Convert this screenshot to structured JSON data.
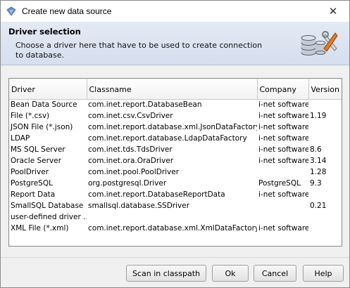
{
  "window": {
    "title": "Create new data source"
  },
  "header": {
    "title": "Driver selection",
    "description": "Choose a driver here that have to be used to create connection to database."
  },
  "table": {
    "columns": [
      "Driver",
      "Classname",
      "Company",
      "Version"
    ],
    "rows": [
      [
        "Bean Data Source",
        "com.inet.report.DatabaseBean",
        "i-net software",
        ""
      ],
      [
        "File (*.csv)",
        "com.inet.csv.CsvDriver",
        "i-net software",
        "1.19"
      ],
      [
        "JSON File (*.json)",
        "com.inet.report.database.xml.JsonDataFactory",
        "i-net software",
        ""
      ],
      [
        "LDAP",
        "com.inet.report.database.LdapDataFactory",
        "i-net software",
        ""
      ],
      [
        "MS SQL Server",
        "com.inet.tds.TdsDriver",
        "i-net software",
        "8.6"
      ],
      [
        "Oracle Server",
        "com.inet.ora.OraDriver",
        "i-net software",
        "3.14"
      ],
      [
        "PoolDriver",
        "com.inet.pool.PoolDriver",
        "",
        "1.28"
      ],
      [
        "PostgreSQL",
        "org.postgresql.Driver",
        "PostgreSQL",
        "9.3"
      ],
      [
        "Report Data",
        "com.inet.report.DatabaseReportData",
        "i-net software",
        ""
      ],
      [
        "SmallSQL Database",
        "smallsql.database.SSDriver",
        "",
        "0.21"
      ],
      [
        "user-defined driver ..",
        "",
        "",
        ""
      ],
      [
        "XML File (*.xml)",
        "com.inet.report.database.xml.XmlDataFactory",
        "i-net software",
        ""
      ]
    ]
  },
  "buttons": {
    "scan": "Scan in classpath",
    "ok": "Ok",
    "cancel": "Cancel",
    "help": "Help"
  },
  "icons": {
    "app": "diamond-icon",
    "close": "close-icon",
    "header": "database-tools-icon"
  }
}
